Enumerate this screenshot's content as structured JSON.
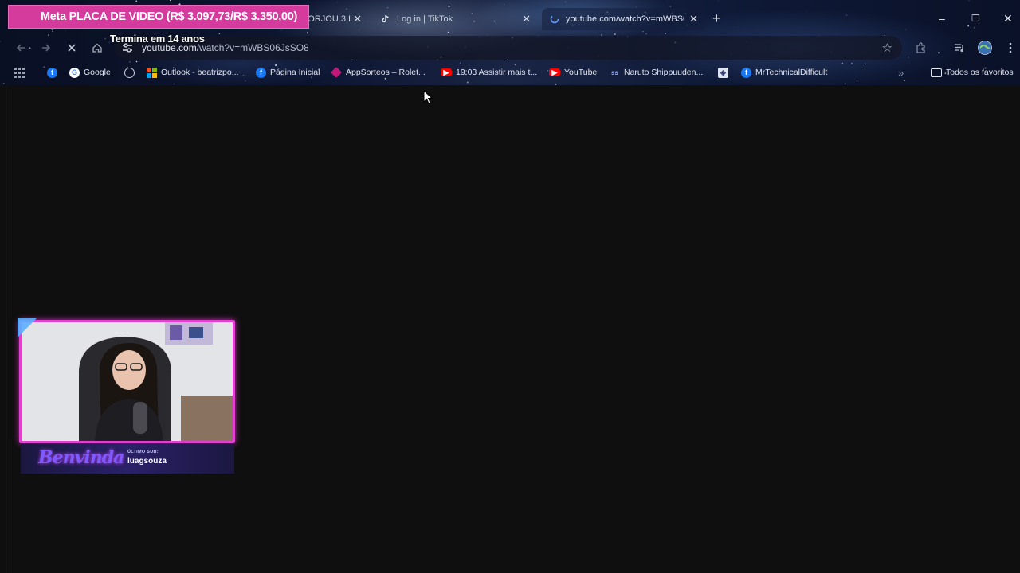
{
  "browser": {
    "tabs": [
      {
        "label": "PM FORJOU 3 I",
        "active": false
      },
      {
        "label": "Log in | TikTok",
        "active": false,
        "icon": "tiktok-icon"
      },
      {
        "label": "youtube.com/watch?v=mWBS0",
        "active": true,
        "icon": "loading-icon"
      }
    ],
    "new_tab_label": "+",
    "window_controls": {
      "minimize": "–",
      "restore": "❐",
      "close": "✕"
    },
    "omnibox": {
      "host": "youtube.com",
      "path": "/watch?v=mWBS06JsSO8"
    },
    "bookmarks": [
      {
        "label": "",
        "icon": "facebook-icon"
      },
      {
        "label": "Google",
        "icon": "google-icon"
      },
      {
        "label": "",
        "icon": "globe-icon"
      },
      {
        "label": "Outlook - beatrizpo...",
        "icon": "microsoft-icon"
      },
      {
        "label": "Página Inicial",
        "icon": "facebook-icon"
      },
      {
        "label": "AppSorteos – Rolet...",
        "icon": "appsorteos-icon"
      },
      {
        "label": "19:03 Assistir mais t...",
        "icon": "youtube-icon"
      },
      {
        "label": "YouTube",
        "icon": "youtube-icon"
      },
      {
        "label": "Naruto Shippuuden...",
        "icon": "naruto-icon"
      },
      {
        "label": "",
        "icon": "generic-site-icon"
      },
      {
        "label": "MrTechnicalDifficult",
        "icon": "facebook-icon"
      }
    ],
    "bookmarks_overflow": "»",
    "all_bookmarks": "Todos os favoritos"
  },
  "overlay": {
    "goal_text": "Meta PLACA DE VIDEO (R$ 3.097,73/R$ 3.350,00)",
    "goal_progress": 0.925,
    "goal_subtext": "Termina em 14 anos",
    "brand": "Benvinda",
    "last_sub_label": "ÚLTIMO SUB:",
    "last_sub_name": "luagsouza"
  },
  "colors": {
    "goal_bar": "#d53a9d",
    "cam_border": "#e33fd0",
    "page_bg": "#0f0f0f"
  }
}
